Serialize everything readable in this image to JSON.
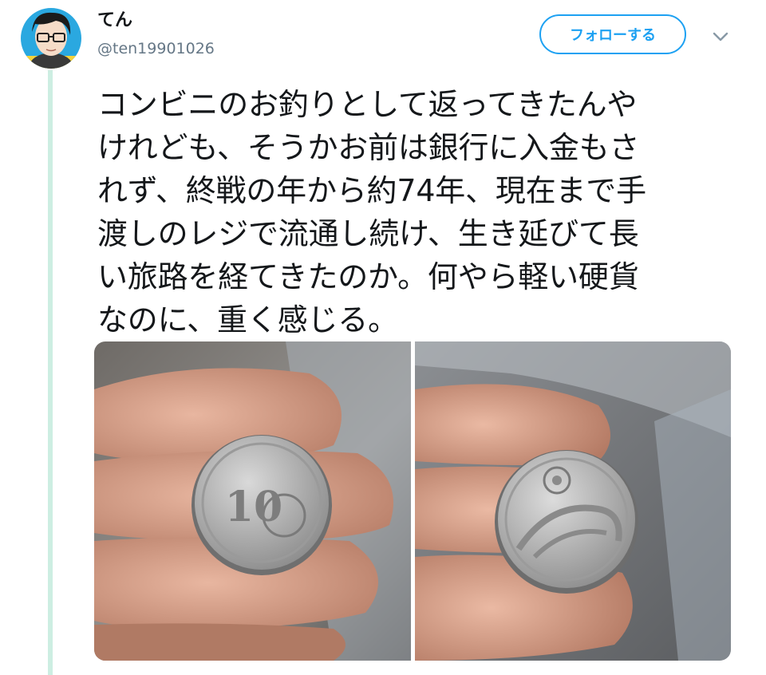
{
  "tweet": {
    "author": {
      "name": "てん",
      "handle": "@ten19901026"
    },
    "follow_label": "フォローする",
    "menu_icon": "chevron-down-icon",
    "text_lines": [
      "コンビニのお釣りとして返ってきたんや",
      "けれども、そうかお前は銀行に入金もさ",
      "れず、終戦の年から約74年、現在まで手",
      "渡しのレジで流通し続け、生き延びて長",
      "い旅路を経てきたのか。何やら軽い硬貨",
      "なのに、重く感じる。"
    ],
    "media": {
      "count": 2,
      "coin_front": {
        "numeral": "10"
      },
      "coin_back": {}
    }
  },
  "colors": {
    "accent": "#1da1f2",
    "thread_line": "#cdeee2",
    "handle_text": "#657786"
  }
}
